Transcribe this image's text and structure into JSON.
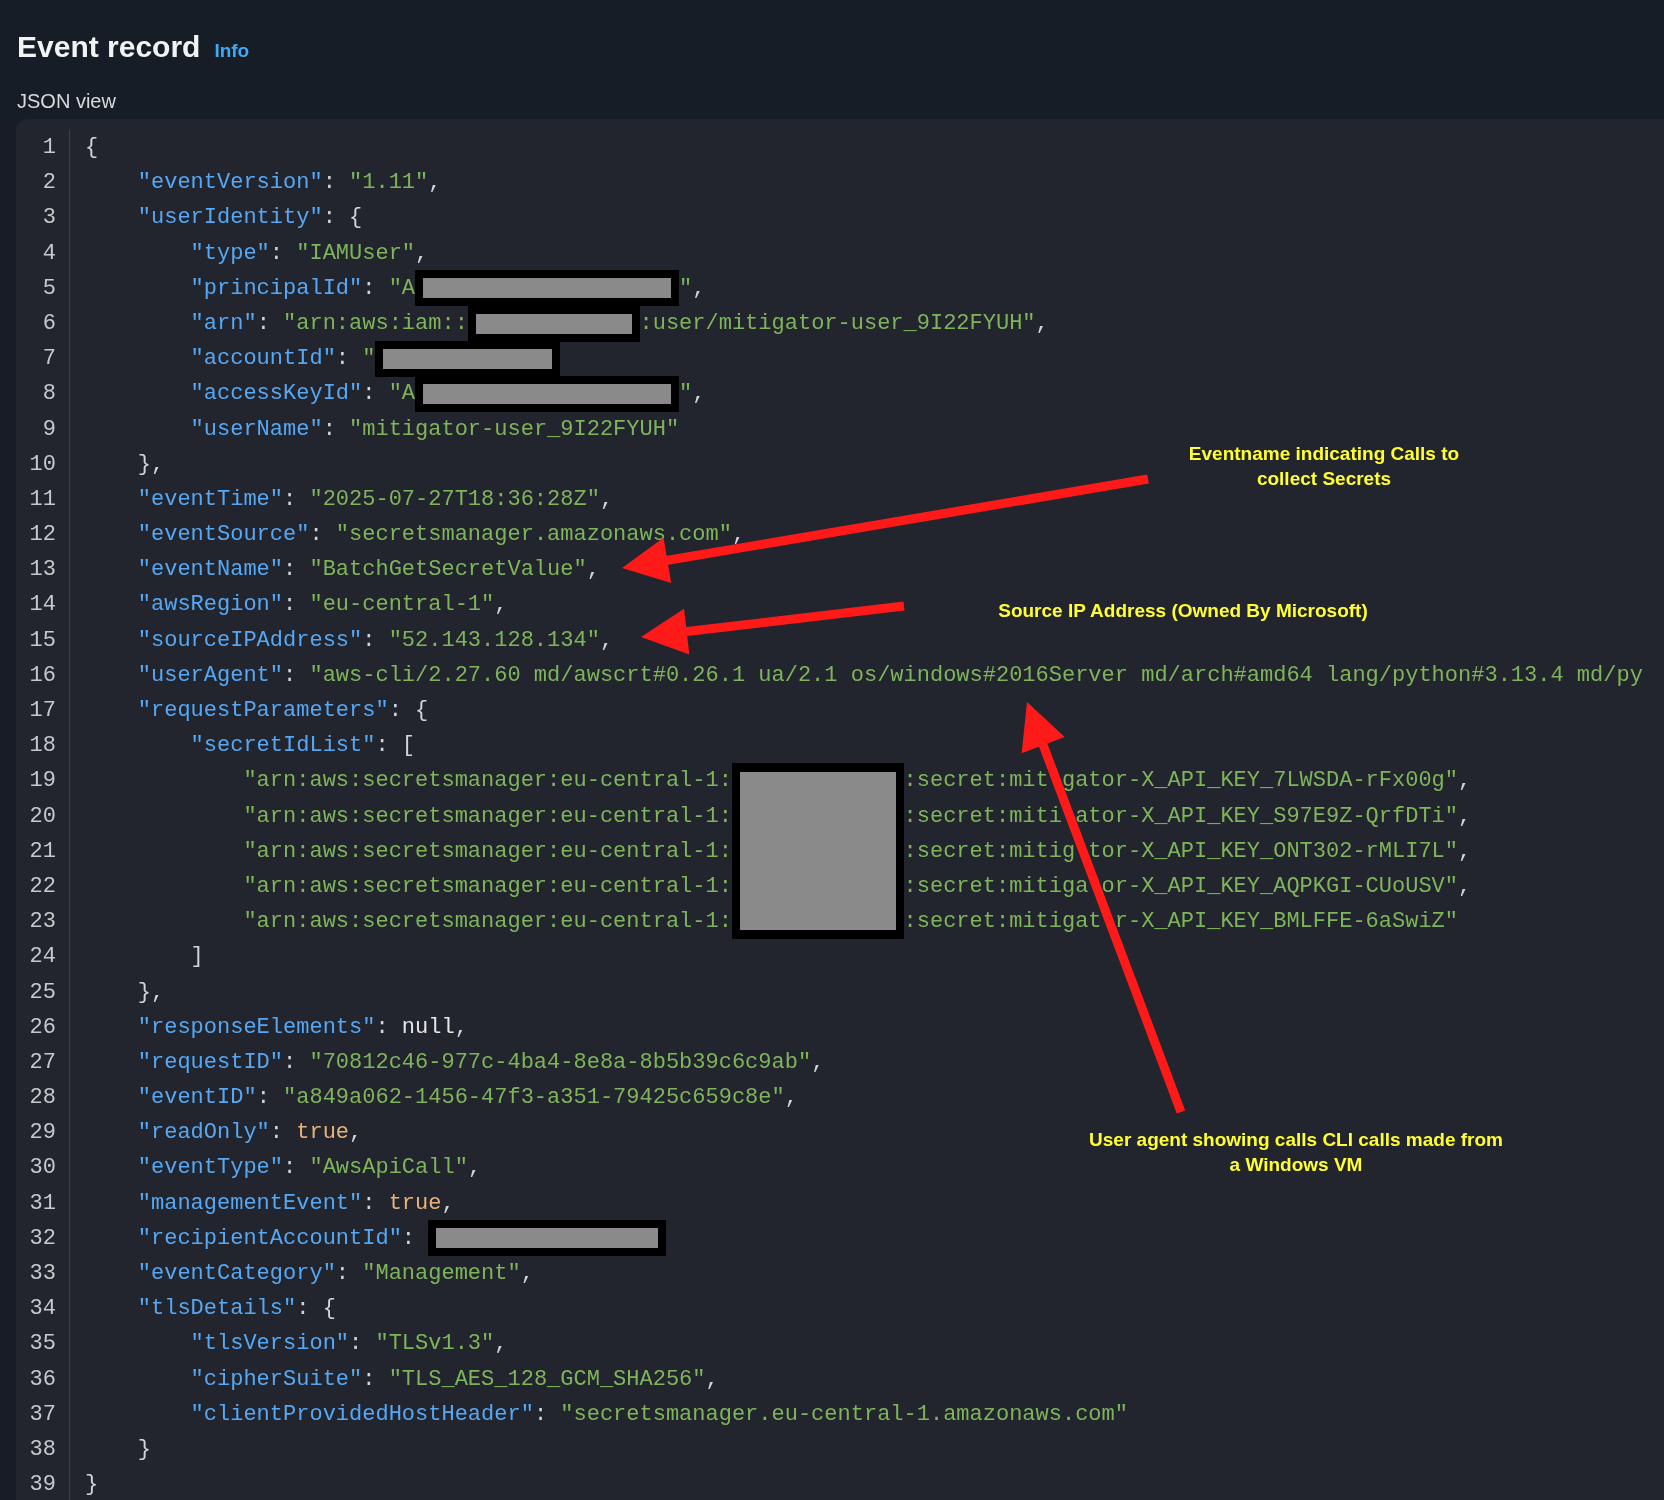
{
  "header": {
    "title": "Event record",
    "info_link": "Info"
  },
  "json_view": {
    "label": "JSON view",
    "lines": [
      {
        "number": "1",
        "tokens": [
          {
            "kind": "punct",
            "text": "{"
          }
        ]
      },
      {
        "number": "2",
        "tokens": [
          {
            "kind": "key",
            "text": "\"eventVersion\""
          },
          {
            "kind": "punct",
            "text": ": "
          },
          {
            "kind": "string",
            "text": "\"1.11\""
          },
          {
            "kind": "punct",
            "text": ","
          }
        ]
      },
      {
        "number": "3",
        "tokens": [
          {
            "kind": "key",
            "text": "\"userIdentity\""
          },
          {
            "kind": "punct",
            "text": ": {"
          }
        ]
      },
      {
        "number": "4",
        "tokens": [
          {
            "kind": "key",
            "text": "\"type\""
          },
          {
            "kind": "punct",
            "text": ": "
          },
          {
            "kind": "string",
            "text": "\"IAMUser\""
          },
          {
            "kind": "punct",
            "text": ","
          }
        ]
      },
      {
        "number": "5",
        "tokens": [
          {
            "kind": "key",
            "text": "\"principalId\""
          },
          {
            "kind": "punct",
            "text": ": "
          },
          {
            "kind": "string",
            "text": "\"A"
          },
          {
            "kind": "redaction"
          },
          {
            "kind": "string",
            "text": "\""
          },
          {
            "kind": "punct",
            "text": ","
          }
        ]
      },
      {
        "number": "6",
        "tokens": [
          {
            "kind": "key",
            "text": "\"arn\""
          },
          {
            "kind": "punct",
            "text": ": "
          },
          {
            "kind": "string",
            "text": "\"arn:aws:iam::"
          },
          {
            "kind": "redaction"
          },
          {
            "kind": "string",
            "text": ":user/mitigator-user_9I22FYUH\""
          },
          {
            "kind": "punct",
            "text": ","
          }
        ]
      },
      {
        "number": "7",
        "tokens": [
          {
            "kind": "key",
            "text": "\"accountId\""
          },
          {
            "kind": "punct",
            "text": ": "
          },
          {
            "kind": "string",
            "text": "\""
          },
          {
            "kind": "redaction"
          }
        ]
      },
      {
        "number": "8",
        "tokens": [
          {
            "kind": "key",
            "text": "\"accessKeyId\""
          },
          {
            "kind": "punct",
            "text": ": "
          },
          {
            "kind": "string",
            "text": "\"A"
          },
          {
            "kind": "redaction"
          },
          {
            "kind": "string",
            "text": "\""
          },
          {
            "kind": "punct",
            "text": ","
          }
        ]
      },
      {
        "number": "9",
        "tokens": [
          {
            "kind": "key",
            "text": "\"userName\""
          },
          {
            "kind": "punct",
            "text": ": "
          },
          {
            "kind": "string",
            "text": "\"mitigator-user_9I22FYUH\""
          }
        ]
      },
      {
        "number": "10",
        "tokens": [
          {
            "kind": "punct",
            "text": "},"
          }
        ]
      },
      {
        "number": "11",
        "tokens": [
          {
            "kind": "key",
            "text": "\"eventTime\""
          },
          {
            "kind": "punct",
            "text": ": "
          },
          {
            "kind": "string",
            "text": "\"2025-07-27T18:36:28Z\""
          },
          {
            "kind": "punct",
            "text": ","
          }
        ]
      },
      {
        "number": "12",
        "tokens": [
          {
            "kind": "key",
            "text": "\"eventSource\""
          },
          {
            "kind": "punct",
            "text": ": "
          },
          {
            "kind": "string",
            "text": "\"secretsmanager.amazonaws.com\""
          },
          {
            "kind": "punct",
            "text": ","
          }
        ]
      },
      {
        "number": "13",
        "tokens": [
          {
            "kind": "key",
            "text": "\"eventName\""
          },
          {
            "kind": "punct",
            "text": ": "
          },
          {
            "kind": "string",
            "text": "\"BatchGetSecretValue\""
          },
          {
            "kind": "punct",
            "text": ","
          }
        ]
      },
      {
        "number": "14",
        "tokens": [
          {
            "kind": "key",
            "text": "\"awsRegion\""
          },
          {
            "kind": "punct",
            "text": ": "
          },
          {
            "kind": "string",
            "text": "\"eu-central-1\""
          },
          {
            "kind": "punct",
            "text": ","
          }
        ]
      },
      {
        "number": "15",
        "tokens": [
          {
            "kind": "key",
            "text": "\"sourceIPAddress\""
          },
          {
            "kind": "punct",
            "text": ": "
          },
          {
            "kind": "string",
            "text": "\"52.143.128.134\""
          },
          {
            "kind": "punct",
            "text": ","
          }
        ]
      },
      {
        "number": "16",
        "tokens": [
          {
            "kind": "key",
            "text": "\"userAgent\""
          },
          {
            "kind": "punct",
            "text": ": "
          },
          {
            "kind": "string",
            "text": "\"aws-cli/2.27.60 md/awscrt#0.26.1 ua/2.1 os/windows#2016Server md/arch#amd64 lang/python#3.13.4 md/py"
          }
        ]
      },
      {
        "number": "17",
        "tokens": [
          {
            "kind": "key",
            "text": "\"requestParameters\""
          },
          {
            "kind": "punct",
            "text": ": {"
          }
        ]
      },
      {
        "number": "18",
        "tokens": [
          {
            "kind": "key",
            "text": "\"secretIdList\""
          },
          {
            "kind": "punct",
            "text": ": ["
          }
        ]
      },
      {
        "number": "19",
        "tokens": [
          {
            "kind": "string",
            "text": "\"arn:aws:secretsmanager:eu-central-1:"
          },
          {
            "kind": "redaction_block"
          },
          {
            "kind": "string",
            "text": ":secret:mit"
          },
          {
            "kind": "covered"
          },
          {
            "kind": "string",
            "text": "gator-X_API_KEY_7LWSDA-rFx00g\""
          },
          {
            "kind": "punct",
            "text": ","
          }
        ]
      },
      {
        "number": "20",
        "tokens": [
          {
            "kind": "string",
            "text": "\"arn:aws:secretsmanager:eu-central-1:"
          },
          {
            "kind": "redaction_block"
          },
          {
            "kind": "string",
            "text": ":secret:miti"
          },
          {
            "kind": "covered"
          },
          {
            "kind": "string",
            "text": "ator-X_API_KEY_S97E9Z-QrfDTi\""
          },
          {
            "kind": "punct",
            "text": ","
          }
        ]
      },
      {
        "number": "21",
        "tokens": [
          {
            "kind": "string",
            "text": "\"arn:aws:secretsmanager:eu-central-1:"
          },
          {
            "kind": "redaction_block"
          },
          {
            "kind": "string",
            "text": ":secret:mitig"
          },
          {
            "kind": "covered"
          },
          {
            "kind": "string",
            "text": "tor-X_API_KEY_ONT302-rMLI7L\""
          },
          {
            "kind": "punct",
            "text": ","
          }
        ]
      },
      {
        "number": "22",
        "tokens": [
          {
            "kind": "string",
            "text": "\"arn:aws:secretsmanager:eu-central-1:"
          },
          {
            "kind": "redaction_block"
          },
          {
            "kind": "string",
            "text": ":secret:mitiga"
          },
          {
            "kind": "covered"
          },
          {
            "kind": "string",
            "text": "or-X_API_KEY_AQPKGI-CUoUSV\""
          },
          {
            "kind": "punct",
            "text": ","
          }
        ]
      },
      {
        "number": "23",
        "tokens": [
          {
            "kind": "string",
            "text": "\"arn:aws:secretsmanager:eu-central-1:"
          },
          {
            "kind": "redaction_block"
          },
          {
            "kind": "string",
            "text": ":secret:mitigat"
          },
          {
            "kind": "covered"
          },
          {
            "kind": "string",
            "text": "r-X_API_KEY_BMLFFE-6aSwiZ\""
          }
        ]
      },
      {
        "number": "24",
        "tokens": [
          {
            "kind": "punct",
            "text": "]"
          }
        ]
      },
      {
        "number": "25",
        "tokens": [
          {
            "kind": "punct",
            "text": "},"
          }
        ]
      },
      {
        "number": "26",
        "tokens": [
          {
            "kind": "key",
            "text": "\"responseElements\""
          },
          {
            "kind": "punct",
            "text": ": "
          },
          {
            "kind": "null",
            "text": "null"
          },
          {
            "kind": "punct",
            "text": ","
          }
        ]
      },
      {
        "number": "27",
        "tokens": [
          {
            "kind": "key",
            "text": "\"requestID\""
          },
          {
            "kind": "punct",
            "text": ": "
          },
          {
            "kind": "string",
            "text": "\"70812c46-977c-4ba4-8e8a-8b5b39c6c9ab\""
          },
          {
            "kind": "punct",
            "text": ","
          }
        ]
      },
      {
        "number": "28",
        "tokens": [
          {
            "kind": "key",
            "text": "\"eventID\""
          },
          {
            "kind": "punct",
            "text": ": "
          },
          {
            "kind": "string",
            "text": "\"a849a062-1456-47f3-a351-79425c659c8e\""
          },
          {
            "kind": "punct",
            "text": ","
          }
        ]
      },
      {
        "number": "29",
        "tokens": [
          {
            "kind": "key",
            "text": "\"readOnly\""
          },
          {
            "kind": "punct",
            "text": ": "
          },
          {
            "kind": "boolean",
            "text": "true"
          },
          {
            "kind": "punct",
            "text": ","
          }
        ]
      },
      {
        "number": "30",
        "tokens": [
          {
            "kind": "key",
            "text": "\"eventType\""
          },
          {
            "kind": "punct",
            "text": ": "
          },
          {
            "kind": "string",
            "text": "\"AwsApiCall\""
          },
          {
            "kind": "punct",
            "text": ","
          }
        ]
      },
      {
        "number": "31",
        "tokens": [
          {
            "kind": "key",
            "text": "\"managementEvent\""
          },
          {
            "kind": "punct",
            "text": ": "
          },
          {
            "kind": "boolean",
            "text": "true"
          },
          {
            "kind": "punct",
            "text": ","
          }
        ]
      },
      {
        "number": "32",
        "tokens": [
          {
            "kind": "key",
            "text": "\"recipientAccountId\""
          },
          {
            "kind": "punct",
            "text": ": "
          },
          {
            "kind": "redaction"
          }
        ]
      },
      {
        "number": "33",
        "tokens": [
          {
            "kind": "key",
            "text": "\"eventCategory\""
          },
          {
            "kind": "punct",
            "text": ": "
          },
          {
            "kind": "string",
            "text": "\"Management\""
          },
          {
            "kind": "punct",
            "text": ","
          }
        ]
      },
      {
        "number": "34",
        "tokens": [
          {
            "kind": "key",
            "text": "\"tlsDetails\""
          },
          {
            "kind": "punct",
            "text": ": {"
          }
        ]
      },
      {
        "number": "35",
        "tokens": [
          {
            "kind": "key",
            "text": "\"tlsVersion\""
          },
          {
            "kind": "punct",
            "text": ": "
          },
          {
            "kind": "string",
            "text": "\"TLSv1.3\""
          },
          {
            "kind": "punct",
            "text": ","
          }
        ]
      },
      {
        "number": "36",
        "tokens": [
          {
            "kind": "key",
            "text": "\"cipherSuite\""
          },
          {
            "kind": "punct",
            "text": ": "
          },
          {
            "kind": "string",
            "text": "\"TLS_AES_128_GCM_SHA256\""
          },
          {
            "kind": "punct",
            "text": ","
          }
        ]
      },
      {
        "number": "37",
        "tokens": [
          {
            "kind": "key",
            "text": "\"clientProvidedHostHeader\""
          },
          {
            "kind": "punct",
            "text": ": "
          },
          {
            "kind": "string",
            "text": "\"secretsmanager.eu-central-1.amazonaws.com\""
          }
        ]
      },
      {
        "number": "38",
        "tokens": [
          {
            "kind": "punct",
            "text": "}"
          }
        ]
      },
      {
        "number": "39",
        "tokens": [
          {
            "kind": "punct",
            "text": "}"
          }
        ]
      }
    ]
  },
  "annotations": [
    {
      "lines": [
        "Eventname indicating Calls to",
        "collect Secrets"
      ]
    },
    {
      "lines": [
        "Source IP Address (Owned By Microsoft)"
      ]
    },
    {
      "lines": [
        "User agent showing calls CLI calls made from",
        "a Windows VM"
      ]
    }
  ]
}
